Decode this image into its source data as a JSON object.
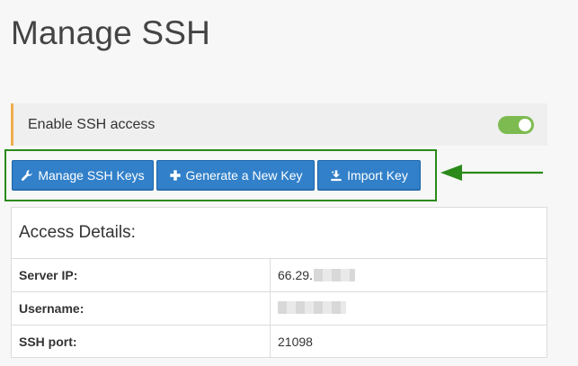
{
  "page": {
    "title": "Manage SSH"
  },
  "ssh_access": {
    "label": "Enable SSH access",
    "enabled": true,
    "toggle_color": "#7dbb51",
    "accent_color": "#f0ad4e"
  },
  "actions": {
    "buttons": [
      {
        "label": "Manage SSH Keys",
        "icon": "wrench-icon"
      },
      {
        "label": "Generate a New Key",
        "icon": "plus-icon"
      },
      {
        "label": "Import Key",
        "icon": "import-icon"
      }
    ],
    "button_color": "#3180c9",
    "highlight_color": "#2b8a1a"
  },
  "access_details": {
    "heading": "Access Details:",
    "rows": [
      {
        "label": "Server IP:",
        "value": "66.29.",
        "redacted": true
      },
      {
        "label": "Username:",
        "value": "",
        "redacted": true
      },
      {
        "label": "SSH port:",
        "value": "21098",
        "redacted": false
      }
    ]
  }
}
